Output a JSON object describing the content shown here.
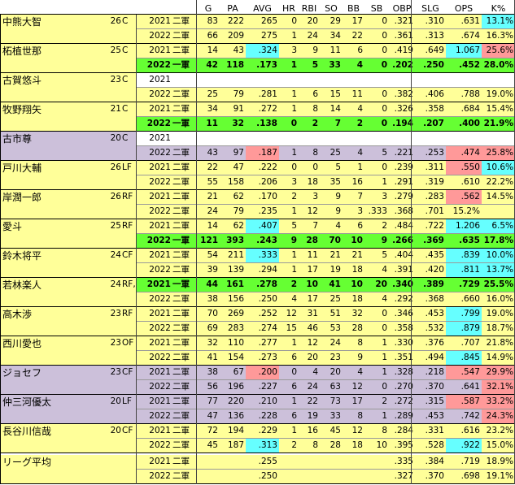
{
  "headers": [
    "G",
    "PA",
    "AVG",
    "HR",
    "RBI",
    "SO",
    "BB",
    "SB",
    "OBP",
    "SLG",
    "OPS",
    "K%"
  ],
  "colors": {
    "yellow": "#ffff99",
    "white": "#ffffff",
    "green": "#66ff33",
    "purple": "#ccc0da",
    "red": "#ff9999",
    "cyan": "#66ffff"
  },
  "players": [
    {
      "name": "中熊大智",
      "age": "26",
      "pos": "C",
      "bg": "yellow",
      "rows": [
        {
          "year": "2021",
          "level": "二軍",
          "bg": "yellow",
          "stats": [
            "83",
            "222",
            "265",
            "0",
            "20",
            "29",
            "17",
            "0",
            ".321",
            ".310",
            ".631",
            "13.1%"
          ],
          "hl": {
            "11": "cyan"
          }
        },
        {
          "year": "2022",
          "level": "二軍",
          "bg": "yellow",
          "stats": [
            "66",
            "209",
            "275",
            "1",
            "24",
            "34",
            "22",
            "0",
            ".361",
            ".313",
            ".674",
            "16.3%"
          ],
          "hl": {}
        }
      ]
    },
    {
      "name": "柘植世那",
      "age": "25",
      "pos": "C",
      "bg": "yellow",
      "rows": [
        {
          "year": "2021",
          "level": "二軍",
          "bg": "yellow",
          "stats": [
            "14",
            "43",
            ".324",
            "3",
            "9",
            "11",
            "6",
            "0",
            ".419",
            ".649",
            "1.067",
            "25.6%"
          ],
          "hl": {
            "2": "cyan",
            "10": "cyan",
            "11": "red"
          }
        },
        {
          "year": "2022",
          "level": "一軍",
          "bg": "green",
          "bold": true,
          "stats": [
            "42",
            "118",
            ".173",
            "1",
            "5",
            "33",
            "4",
            "0",
            ".202",
            ".250",
            ".452",
            "28.0%"
          ],
          "hl": {}
        }
      ]
    },
    {
      "name": "古賀悠斗",
      "age": "23",
      "pos": "C",
      "bg": "yellow",
      "rows": [
        {
          "year": "2021",
          "level": "",
          "bg": "white",
          "stats": [
            "",
            "",
            "",
            "",
            "",
            "",
            "",
            "",
            "",
            "",
            "",
            ""
          ],
          "hl": {}
        },
        {
          "year": "2022",
          "level": "二軍",
          "bg": "yellow",
          "stats": [
            "25",
            "79",
            ".281",
            "1",
            "6",
            "15",
            "11",
            "0",
            ".382",
            ".406",
            ".788",
            "19.0%"
          ],
          "hl": {}
        }
      ]
    },
    {
      "name": "牧野翔矢",
      "age": "21",
      "pos": "C",
      "bg": "yellow",
      "rows": [
        {
          "year": "2021",
          "level": "二軍",
          "bg": "yellow",
          "stats": [
            "34",
            "91",
            ".272",
            "1",
            "8",
            "14",
            "4",
            "0",
            ".326",
            ".358",
            ".684",
            "15.4%"
          ],
          "hl": {}
        },
        {
          "year": "2022",
          "level": "一軍",
          "bg": "green",
          "bold": true,
          "stats": [
            "11",
            "32",
            ".138",
            "0",
            "2",
            "7",
            "2",
            "0",
            ".194",
            ".207",
            ".400",
            "21.9%"
          ],
          "hl": {}
        }
      ]
    },
    {
      "name": "古市尊",
      "age": "20",
      "pos": "C",
      "bg": "purple",
      "rows": [
        {
          "year": "2021",
          "level": "",
          "bg": "white",
          "stats": [
            "",
            "",
            "",
            "",
            "",
            "",
            "",
            "",
            "",
            "",
            "",
            ""
          ],
          "hl": {}
        },
        {
          "year": "2022",
          "level": "二軍",
          "bg": "purple",
          "stats": [
            "43",
            "97",
            ".187",
            "1",
            "8",
            "25",
            "4",
            "5",
            ".221",
            ".253",
            ".474",
            "25.8%"
          ],
          "hl": {
            "2": "red",
            "10": "red",
            "11": "red"
          }
        }
      ]
    },
    {
      "name": "戸川大輔",
      "age": "26",
      "pos": "LF",
      "bg": "yellow",
      "rows": [
        {
          "year": "2021",
          "level": "二軍",
          "bg": "yellow",
          "stats": [
            "22",
            "47",
            ".222",
            "0",
            "0",
            "5",
            "1",
            "0",
            ".239",
            ".311",
            ".550",
            "10.6%"
          ],
          "hl": {
            "10": "red",
            "11": "cyan"
          }
        },
        {
          "year": "2022",
          "level": "二軍",
          "bg": "yellow",
          "stats": [
            "55",
            "158",
            ".206",
            "3",
            "18",
            "35",
            "16",
            "1",
            ".291",
            ".319",
            ".610",
            "22.2%"
          ],
          "hl": {}
        }
      ]
    },
    {
      "name": "岸潤一郎",
      "age": "26",
      "pos": "RF",
      "bg": "yellow",
      "rows": [
        {
          "year": "2021",
          "level": "二軍",
          "bg": "yellow",
          "stats": [
            "21",
            "62",
            ".170",
            "2",
            "3",
            "9",
            "7",
            "3",
            ".279",
            ".283",
            ".562",
            "14.5%"
          ],
          "hl": {
            "10": "red"
          }
        },
        {
          "year": "2022",
          "level": "二軍",
          "bg": "yellow",
          "stats": [
            "24",
            "79",
            ".235",
            "1",
            "12",
            "9",
            "3",
            ".333",
            ".368",
            ".701",
            "15.2%",
            ""
          ],
          "hl": {}
        }
      ]
    },
    {
      "name": "愛斗",
      "age": "25",
      "pos": "RF",
      "bg": "yellow",
      "rows": [
        {
          "year": "2021",
          "level": "二軍",
          "bg": "yellow",
          "stats": [
            "14",
            "62",
            ".407",
            "5",
            "7",
            "4",
            "6",
            "2",
            ".484",
            ".722",
            "1.206",
            "6.5%"
          ],
          "hl": {
            "2": "cyan",
            "10": "cyan",
            "11": "cyan"
          }
        },
        {
          "year": "2022",
          "level": "一軍",
          "bg": "green",
          "bold": true,
          "stats": [
            "121",
            "393",
            ".243",
            "9",
            "28",
            "70",
            "10",
            "9",
            ".266",
            ".369",
            ".635",
            "17.8%"
          ],
          "hl": {}
        }
      ]
    },
    {
      "name": "鈴木将平",
      "age": "24",
      "pos": "CF",
      "bg": "yellow",
      "rows": [
        {
          "year": "2021",
          "level": "二軍",
          "bg": "yellow",
          "stats": [
            "54",
            "211",
            ".333",
            "1",
            "11",
            "21",
            "21",
            "5",
            ".404",
            ".435",
            ".839",
            "10.0%"
          ],
          "hl": {
            "2": "cyan",
            "10": "cyan",
            "11": "cyan"
          }
        },
        {
          "year": "2022",
          "level": "二軍",
          "bg": "yellow",
          "stats": [
            "39",
            "139",
            ".294",
            "1",
            "17",
            "19",
            "18",
            "4",
            ".391",
            ".420",
            ".811",
            "13.7%"
          ],
          "hl": {
            "10": "cyan",
            "11": "cyan"
          }
        }
      ]
    },
    {
      "name": "若林楽人",
      "age": "24",
      "pos": "RF,CF",
      "bg": "yellow",
      "rows": [
        {
          "year": "2021",
          "level": "一軍",
          "bg": "green",
          "bold": true,
          "stats": [
            "44",
            "161",
            ".278",
            "2",
            "10",
            "41",
            "10",
            "20",
            ".340",
            ".389",
            ".729",
            "25.5%"
          ],
          "hl": {}
        },
        {
          "year": "2022",
          "level": "二軍",
          "bg": "yellow",
          "stats": [
            "38",
            "156",
            ".250",
            "4",
            "17",
            "25",
            "18",
            "4",
            ".292",
            ".368",
            ".660",
            "16.0%"
          ],
          "hl": {}
        }
      ]
    },
    {
      "name": "高木渉",
      "age": "23",
      "pos": "RF",
      "bg": "yellow",
      "rows": [
        {
          "year": "2021",
          "level": "二軍",
          "bg": "yellow",
          "stats": [
            "70",
            "269",
            ".252",
            "12",
            "31",
            "51",
            "32",
            "0",
            ".346",
            ".453",
            ".799",
            "19.0%"
          ],
          "hl": {
            "10": "cyan"
          }
        },
        {
          "year": "2022",
          "level": "二軍",
          "bg": "yellow",
          "stats": [
            "69",
            "283",
            ".274",
            "15",
            "46",
            "53",
            "28",
            "0",
            ".358",
            ".532",
            ".879",
            "18.7%"
          ],
          "hl": {
            "10": "cyan"
          }
        }
      ]
    },
    {
      "name": "西川愛也",
      "age": "23",
      "pos": "OF",
      "bg": "yellow",
      "rows": [
        {
          "year": "2021",
          "level": "二軍",
          "bg": "yellow",
          "stats": [
            "32",
            "110",
            ".277",
            "1",
            "12",
            "24",
            "8",
            "1",
            ".330",
            ".376",
            ".707",
            "21.8%"
          ],
          "hl": {}
        },
        {
          "year": "2022",
          "level": "二軍",
          "bg": "yellow",
          "stats": [
            "41",
            "154",
            ".273",
            "6",
            "20",
            "23",
            "9",
            "1",
            ".351",
            ".494",
            ".845",
            "14.9%"
          ],
          "hl": {
            "10": "cyan"
          }
        }
      ]
    },
    {
      "name": "ジョセフ",
      "age": "23",
      "pos": "CF",
      "bg": "purple",
      "rows": [
        {
          "year": "2021",
          "level": "二軍",
          "bg": "purple",
          "stats": [
            "38",
            "67",
            ".200",
            "0",
            "4",
            "20",
            "4",
            "1",
            ".328",
            ".218",
            ".547",
            "29.9%"
          ],
          "hl": {
            "2": "red",
            "10": "red",
            "11": "red"
          }
        },
        {
          "year": "2022",
          "level": "二軍",
          "bg": "purple",
          "stats": [
            "56",
            "196",
            ".227",
            "6",
            "24",
            "63",
            "12",
            "0",
            ".270",
            ".370",
            ".641",
            "32.1%"
          ],
          "hl": {
            "11": "red"
          }
        }
      ]
    },
    {
      "name": "仲三河優太",
      "age": "20",
      "pos": "LF",
      "bg": "purple",
      "rows": [
        {
          "year": "2021",
          "level": "二軍",
          "bg": "purple",
          "stats": [
            "77",
            "220",
            ".210",
            "1",
            "22",
            "73",
            "17",
            "2",
            ".272",
            ".315",
            ".587",
            "33.2%"
          ],
          "hl": {
            "10": "red",
            "11": "red"
          }
        },
        {
          "year": "2022",
          "level": "二軍",
          "bg": "purple",
          "stats": [
            "47",
            "136",
            ".228",
            "6",
            "19",
            "33",
            "8",
            "1",
            ".289",
            ".453",
            ".742",
            "24.3%"
          ],
          "hl": {
            "11": "red"
          }
        }
      ]
    },
    {
      "name": "長谷川信哉",
      "age": "20",
      "pos": "CF",
      "bg": "yellow",
      "rows": [
        {
          "year": "2021",
          "level": "二軍",
          "bg": "yellow",
          "stats": [
            "72",
            "194",
            ".229",
            "1",
            "16",
            "45",
            "12",
            "8",
            ".284",
            ".331",
            ".616",
            "23.2%"
          ],
          "hl": {}
        },
        {
          "year": "2022",
          "level": "二軍",
          "bg": "yellow",
          "stats": [
            "45",
            "187",
            ".313",
            "2",
            "8",
            "28",
            "18",
            "10",
            ".395",
            ".528",
            ".922",
            "15.0%"
          ],
          "hl": {
            "2": "cyan",
            "10": "cyan"
          }
        }
      ]
    }
  ],
  "league": {
    "name": "リーグ平均",
    "rows": [
      {
        "year": "2021",
        "level": "二軍",
        "stats": [
          "",
          "",
          ".255",
          "",
          "",
          "",
          "",
          "",
          ".335",
          ".384",
          ".719",
          "18.9%"
        ]
      },
      {
        "year": "2022",
        "level": "二軍",
        "stats": [
          "",
          "",
          ".250",
          "",
          "",
          "",
          "",
          "",
          ".327",
          ".370",
          ".698",
          "19.1%"
        ]
      }
    ]
  }
}
